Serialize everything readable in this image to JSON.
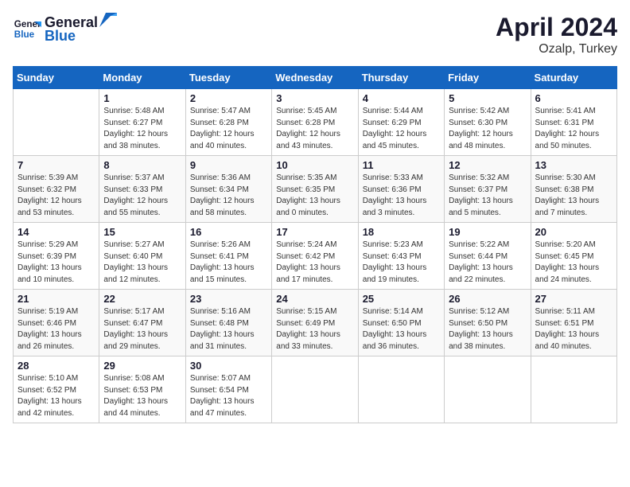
{
  "header": {
    "logo_line1": "General",
    "logo_line2": "Blue",
    "month": "April 2024",
    "location": "Ozalp, Turkey"
  },
  "days_of_week": [
    "Sunday",
    "Monday",
    "Tuesday",
    "Wednesday",
    "Thursday",
    "Friday",
    "Saturday"
  ],
  "weeks": [
    [
      {
        "num": "",
        "info": ""
      },
      {
        "num": "1",
        "info": "Sunrise: 5:48 AM\nSunset: 6:27 PM\nDaylight: 12 hours\nand 38 minutes."
      },
      {
        "num": "2",
        "info": "Sunrise: 5:47 AM\nSunset: 6:28 PM\nDaylight: 12 hours\nand 40 minutes."
      },
      {
        "num": "3",
        "info": "Sunrise: 5:45 AM\nSunset: 6:28 PM\nDaylight: 12 hours\nand 43 minutes."
      },
      {
        "num": "4",
        "info": "Sunrise: 5:44 AM\nSunset: 6:29 PM\nDaylight: 12 hours\nand 45 minutes."
      },
      {
        "num": "5",
        "info": "Sunrise: 5:42 AM\nSunset: 6:30 PM\nDaylight: 12 hours\nand 48 minutes."
      },
      {
        "num": "6",
        "info": "Sunrise: 5:41 AM\nSunset: 6:31 PM\nDaylight: 12 hours\nand 50 minutes."
      }
    ],
    [
      {
        "num": "7",
        "info": "Sunrise: 5:39 AM\nSunset: 6:32 PM\nDaylight: 12 hours\nand 53 minutes."
      },
      {
        "num": "8",
        "info": "Sunrise: 5:37 AM\nSunset: 6:33 PM\nDaylight: 12 hours\nand 55 minutes."
      },
      {
        "num": "9",
        "info": "Sunrise: 5:36 AM\nSunset: 6:34 PM\nDaylight: 12 hours\nand 58 minutes."
      },
      {
        "num": "10",
        "info": "Sunrise: 5:35 AM\nSunset: 6:35 PM\nDaylight: 13 hours\nand 0 minutes."
      },
      {
        "num": "11",
        "info": "Sunrise: 5:33 AM\nSunset: 6:36 PM\nDaylight: 13 hours\nand 3 minutes."
      },
      {
        "num": "12",
        "info": "Sunrise: 5:32 AM\nSunset: 6:37 PM\nDaylight: 13 hours\nand 5 minutes."
      },
      {
        "num": "13",
        "info": "Sunrise: 5:30 AM\nSunset: 6:38 PM\nDaylight: 13 hours\nand 7 minutes."
      }
    ],
    [
      {
        "num": "14",
        "info": "Sunrise: 5:29 AM\nSunset: 6:39 PM\nDaylight: 13 hours\nand 10 minutes."
      },
      {
        "num": "15",
        "info": "Sunrise: 5:27 AM\nSunset: 6:40 PM\nDaylight: 13 hours\nand 12 minutes."
      },
      {
        "num": "16",
        "info": "Sunrise: 5:26 AM\nSunset: 6:41 PM\nDaylight: 13 hours\nand 15 minutes."
      },
      {
        "num": "17",
        "info": "Sunrise: 5:24 AM\nSunset: 6:42 PM\nDaylight: 13 hours\nand 17 minutes."
      },
      {
        "num": "18",
        "info": "Sunrise: 5:23 AM\nSunset: 6:43 PM\nDaylight: 13 hours\nand 19 minutes."
      },
      {
        "num": "19",
        "info": "Sunrise: 5:22 AM\nSunset: 6:44 PM\nDaylight: 13 hours\nand 22 minutes."
      },
      {
        "num": "20",
        "info": "Sunrise: 5:20 AM\nSunset: 6:45 PM\nDaylight: 13 hours\nand 24 minutes."
      }
    ],
    [
      {
        "num": "21",
        "info": "Sunrise: 5:19 AM\nSunset: 6:46 PM\nDaylight: 13 hours\nand 26 minutes."
      },
      {
        "num": "22",
        "info": "Sunrise: 5:17 AM\nSunset: 6:47 PM\nDaylight: 13 hours\nand 29 minutes."
      },
      {
        "num": "23",
        "info": "Sunrise: 5:16 AM\nSunset: 6:48 PM\nDaylight: 13 hours\nand 31 minutes."
      },
      {
        "num": "24",
        "info": "Sunrise: 5:15 AM\nSunset: 6:49 PM\nDaylight: 13 hours\nand 33 minutes."
      },
      {
        "num": "25",
        "info": "Sunrise: 5:14 AM\nSunset: 6:50 PM\nDaylight: 13 hours\nand 36 minutes."
      },
      {
        "num": "26",
        "info": "Sunrise: 5:12 AM\nSunset: 6:50 PM\nDaylight: 13 hours\nand 38 minutes."
      },
      {
        "num": "27",
        "info": "Sunrise: 5:11 AM\nSunset: 6:51 PM\nDaylight: 13 hours\nand 40 minutes."
      }
    ],
    [
      {
        "num": "28",
        "info": "Sunrise: 5:10 AM\nSunset: 6:52 PM\nDaylight: 13 hours\nand 42 minutes."
      },
      {
        "num": "29",
        "info": "Sunrise: 5:08 AM\nSunset: 6:53 PM\nDaylight: 13 hours\nand 44 minutes."
      },
      {
        "num": "30",
        "info": "Sunrise: 5:07 AM\nSunset: 6:54 PM\nDaylight: 13 hours\nand 47 minutes."
      },
      {
        "num": "",
        "info": ""
      },
      {
        "num": "",
        "info": ""
      },
      {
        "num": "",
        "info": ""
      },
      {
        "num": "",
        "info": ""
      }
    ]
  ]
}
